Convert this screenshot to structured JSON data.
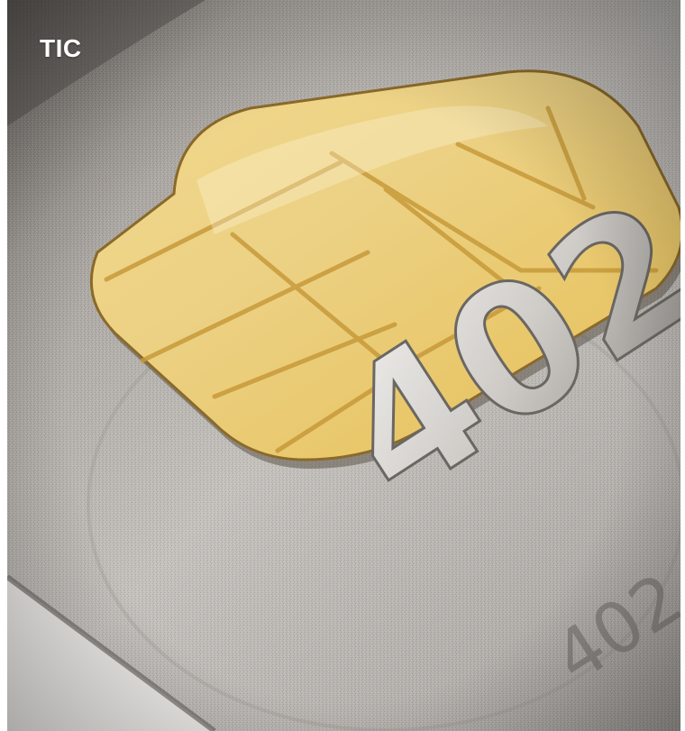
{
  "label": "TIC",
  "photo": {
    "subject": "credit-card-emv-chip-closeup",
    "embossed_digits_large": "402",
    "embossed_digits_small": "402"
  },
  "colors": {
    "card_surface": "#b9b6b2",
    "chip_gold": "#e7c777",
    "chip_line": "#c79a3a",
    "label_text": "#ffffff"
  }
}
